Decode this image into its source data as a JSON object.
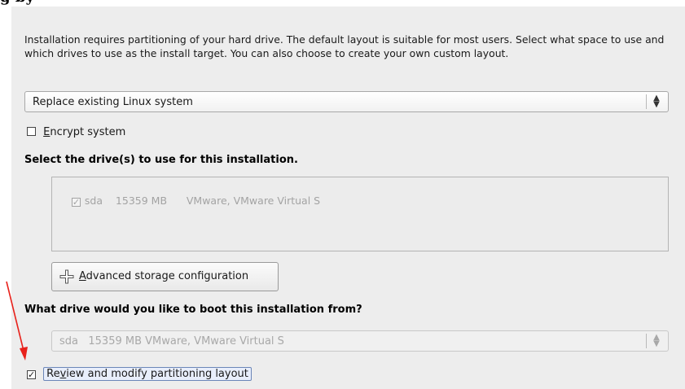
{
  "page_title": "g by",
  "intro_text": "Installation requires partitioning of your hard drive.  The default layout is suitable for most users.  Select what space to use and which drives to use as the install target. You can also choose to create your own custom layout.",
  "layout_combo": {
    "selected": "Replace existing Linux system"
  },
  "encrypt": {
    "label": "Encrypt system",
    "checked": false
  },
  "drives_heading": "Select the drive(s) to use for this installation.",
  "drives": [
    {
      "name": "sda",
      "size": "15359 MB",
      "model": "VMware, VMware Virtual S",
      "checked": true
    }
  ],
  "advanced_button": {
    "label": "Advanced storage configuration"
  },
  "boot_heading": "What drive would you like to boot this installation from?",
  "boot_combo": {
    "selected": "sda   15359 MB VMware, VMware Virtual S"
  },
  "review": {
    "label": "Review and modify partitioning layout",
    "checked": true
  },
  "icons": {
    "combo": "up-down-arrows-icon",
    "advanced": "plus-icon",
    "annotation": "red-arrow-annotation"
  },
  "colors": {
    "annotation_arrow": "#e8211b",
    "panel_bg": "#ededed",
    "focus_border": "#6b86b8"
  }
}
